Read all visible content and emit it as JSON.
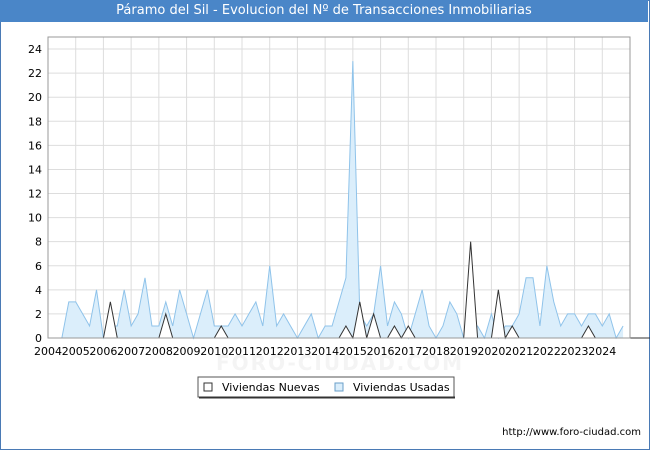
{
  "title": "Páramo del Sil - Evolucion del Nº de Transacciones Inmobiliarias",
  "source": "http://www.foro-ciudad.com",
  "watermark": "FORO-CIUDAD.COM",
  "colors": {
    "title_bg": "#4a86c8",
    "nuevas_fill": "#ffffff",
    "nuevas_line": "#333333",
    "usadas_fill": "#dbeefb",
    "usadas_line": "#8fc3ea"
  },
  "chart_data": {
    "type": "area",
    "title": "Páramo del Sil - Evolucion del Nº de Transacciones Inmobiliarias",
    "xlabel": "",
    "ylabel": "",
    "x_unit": "quarter (from 2004 Q1)",
    "xlim": [
      2004,
      2025
    ],
    "ylim": [
      0,
      25
    ],
    "yticks": [
      0,
      2,
      4,
      6,
      8,
      10,
      12,
      14,
      16,
      18,
      20,
      22,
      24
    ],
    "xtick_labels": [
      "2004",
      "2005",
      "2006",
      "2007",
      "2008",
      "2009",
      "2010",
      "2011",
      "2012",
      "2013",
      "2014",
      "2015",
      "2016",
      "2017",
      "2018",
      "2019",
      "2020",
      "2021",
      "2022",
      "2023",
      "2024"
    ],
    "grid": true,
    "legend_position": "bottom-center",
    "series": [
      {
        "name": "Viviendas Nuevas",
        "values": [
          0,
          0,
          0,
          0,
          0,
          0,
          0,
          0,
          0,
          3,
          0,
          0,
          0,
          0,
          0,
          0,
          0,
          2,
          0,
          0,
          0,
          0,
          0,
          0,
          0,
          1,
          0,
          0,
          0,
          0,
          0,
          0,
          0,
          0,
          0,
          0,
          0,
          0,
          0,
          0,
          0,
          0,
          0,
          1,
          0,
          3,
          0,
          2,
          0,
          0,
          1,
          0,
          1,
          0,
          0,
          0,
          0,
          0,
          0,
          0,
          0,
          8,
          0,
          0,
          0,
          4,
          0,
          1,
          0,
          0,
          0,
          0,
          0,
          0,
          0,
          0,
          0,
          0,
          1,
          0,
          0,
          0,
          0,
          0,
          0,
          0,
          0,
          0,
          0,
          0,
          0,
          0,
          0,
          0,
          0,
          0,
          0,
          0,
          0,
          0,
          0,
          0,
          0,
          0,
          0,
          0,
          0,
          0
        ]
      },
      {
        "name": "Viviendas Usadas",
        "values": [
          0,
          0,
          0,
          3,
          3,
          2,
          1,
          4,
          0,
          1,
          1,
          4,
          1,
          2,
          5,
          1,
          1,
          3,
          1,
          4,
          2,
          0,
          2,
          4,
          1,
          1,
          1,
          2,
          1,
          2,
          3,
          1,
          6,
          1,
          2,
          1,
          0,
          1,
          2,
          0,
          1,
          1,
          3,
          5,
          23,
          2,
          1,
          2,
          6,
          1,
          3,
          2,
          0,
          2,
          4,
          1,
          0,
          1,
          3,
          2,
          0,
          1,
          1,
          0,
          2,
          0,
          1,
          1,
          2,
          5,
          5,
          1,
          6,
          3,
          1,
          2,
          2,
          1,
          2,
          2,
          1,
          2,
          0,
          1
        ]
      }
    ]
  }
}
